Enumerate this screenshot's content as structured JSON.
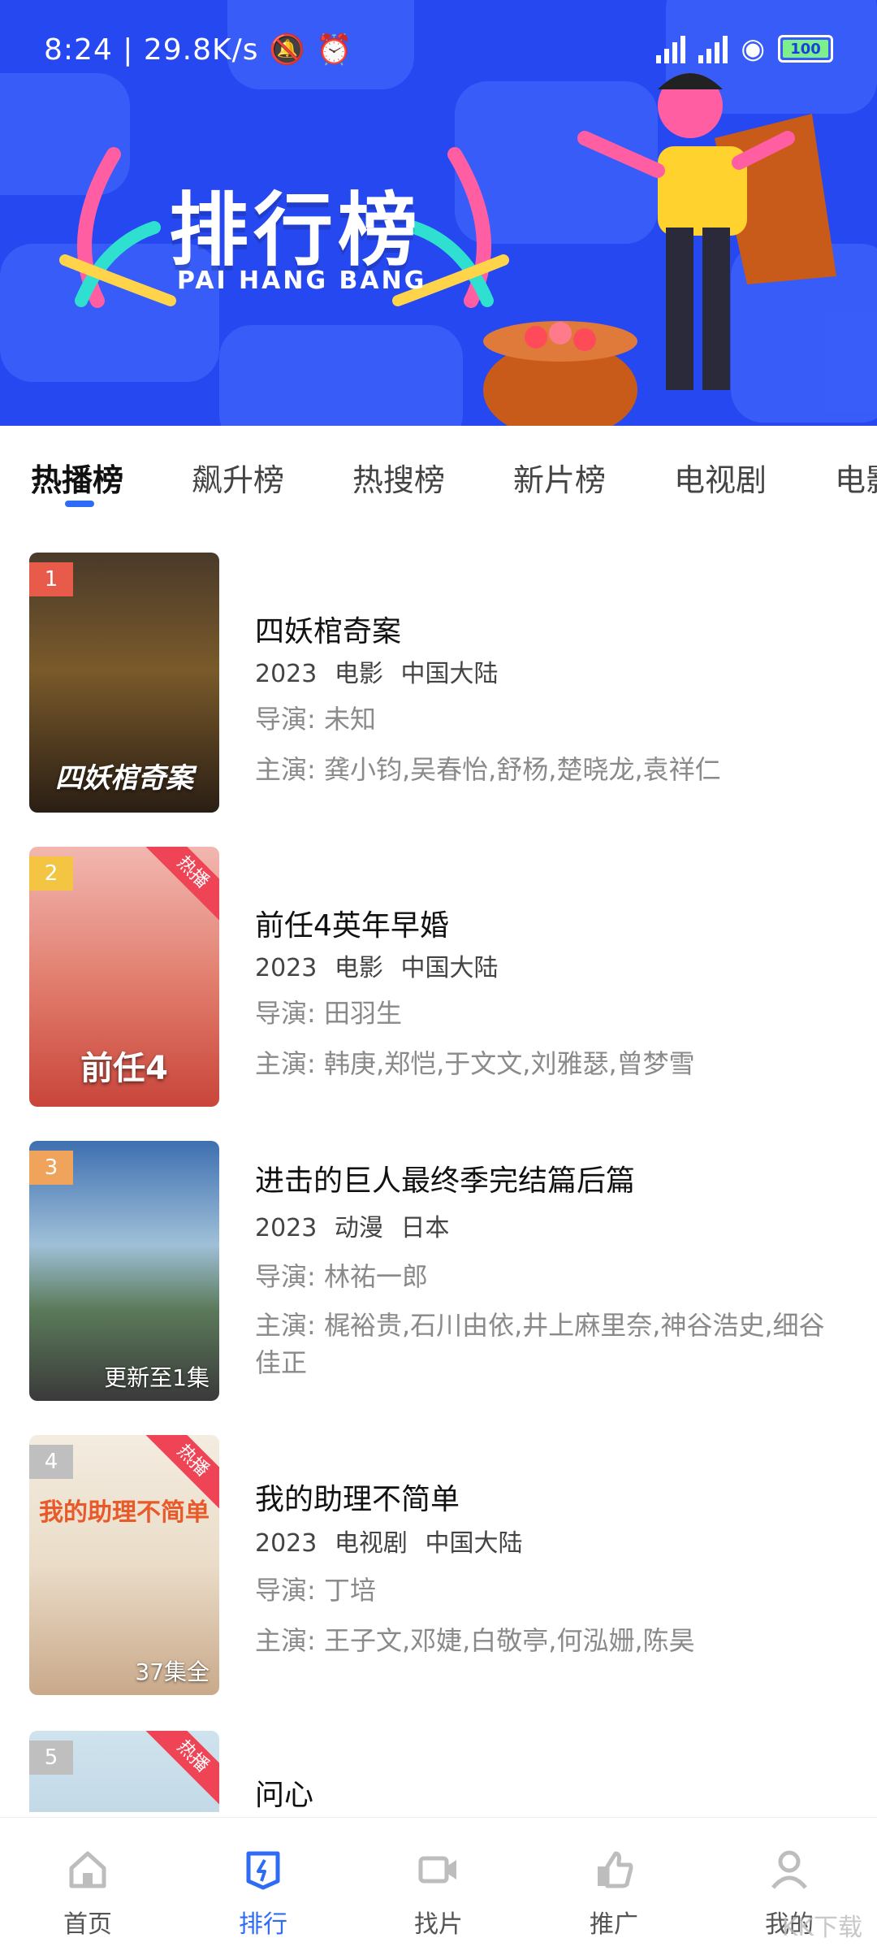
{
  "status_bar": {
    "time": "8:24",
    "speed": "29.8K/s",
    "battery": "100"
  },
  "banner": {
    "title_cn": "排行榜",
    "title_en": "PAI HANG BANG"
  },
  "tabs": [
    {
      "label": "热播榜",
      "active": true
    },
    {
      "label": "飙升榜"
    },
    {
      "label": "热搜榜"
    },
    {
      "label": "新片榜"
    },
    {
      "label": "电视剧"
    },
    {
      "label": "电影"
    }
  ],
  "items": [
    {
      "rank": "1",
      "rank_color": "#e85a4a",
      "title": "四妖棺奇案",
      "year": "2023",
      "genre": "电影",
      "region": "中国大陆",
      "director": "导演: 未知",
      "cast": "主演: 龚小钧,吴春怡,舒杨,楚晓龙,袁祥仁",
      "poster_overlay": "",
      "hot": ""
    },
    {
      "rank": "2",
      "rank_color": "#f4c542",
      "title": "前任4英年早婚",
      "year": "2023",
      "genre": "电影",
      "region": "中国大陆",
      "director": "导演: 田羽生",
      "cast": "主演: 韩庚,郑恺,于文文,刘雅瑟,曾梦雪",
      "poster_overlay": "",
      "hot": "热播"
    },
    {
      "rank": "3",
      "rank_color": "#f0a35a",
      "title": "进击的巨人最终季完结篇后篇",
      "year": "2023",
      "genre": "动漫",
      "region": "日本",
      "director": "导演: 林祐一郎",
      "cast": "主演: 梶裕贵,石川由依,井上麻里奈,神谷浩史,细谷佳正",
      "poster_overlay": "更新至1集",
      "hot": ""
    },
    {
      "rank": "4",
      "rank_color": "#bfbfbf",
      "title": "我的助理不简单",
      "year": "2023",
      "genre": "电视剧",
      "region": "中国大陆",
      "director": "导演: 丁培",
      "cast": "主演: 王子文,邓婕,白敬亭,何泓姗,陈昊",
      "poster_overlay": "37集全",
      "hot": "热播"
    },
    {
      "rank": "5",
      "rank_color": "#bfbfbf",
      "title": "问心",
      "year": "",
      "genre": "",
      "region": "",
      "director": "",
      "cast": "",
      "poster_overlay": "",
      "hot": "热播"
    }
  ],
  "nav": [
    {
      "label": "首页",
      "icon": "home-icon"
    },
    {
      "label": "排行",
      "icon": "ranking-icon",
      "active": true
    },
    {
      "label": "找片",
      "icon": "video-camera-icon"
    },
    {
      "label": "推广",
      "icon": "thumbs-up-icon"
    },
    {
      "label": "我的",
      "icon": "user-icon"
    }
  ],
  "watermark": "KK下载"
}
